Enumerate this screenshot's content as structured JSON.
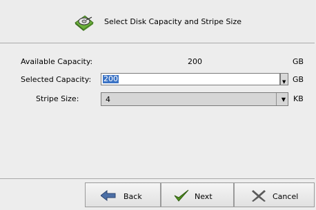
{
  "header": {
    "title": "Select Disk Capacity and Stripe Size",
    "icon": "disk-icon"
  },
  "form": {
    "available": {
      "label": "Available Capacity:",
      "value": "200",
      "unit": "GB"
    },
    "selected": {
      "label": "Selected Capacity:",
      "value": "200",
      "unit": "GB"
    },
    "stripe": {
      "label": "Stripe Size:",
      "value": "4",
      "unit": "KB"
    }
  },
  "buttons": {
    "back": "Back",
    "next": "Next",
    "cancel": "Cancel"
  },
  "colors": {
    "selection": "#3b73c5",
    "next_check": "#4f8f1e",
    "cancel_x": "#5b5b5b",
    "arrow": "#4b6fa6"
  }
}
